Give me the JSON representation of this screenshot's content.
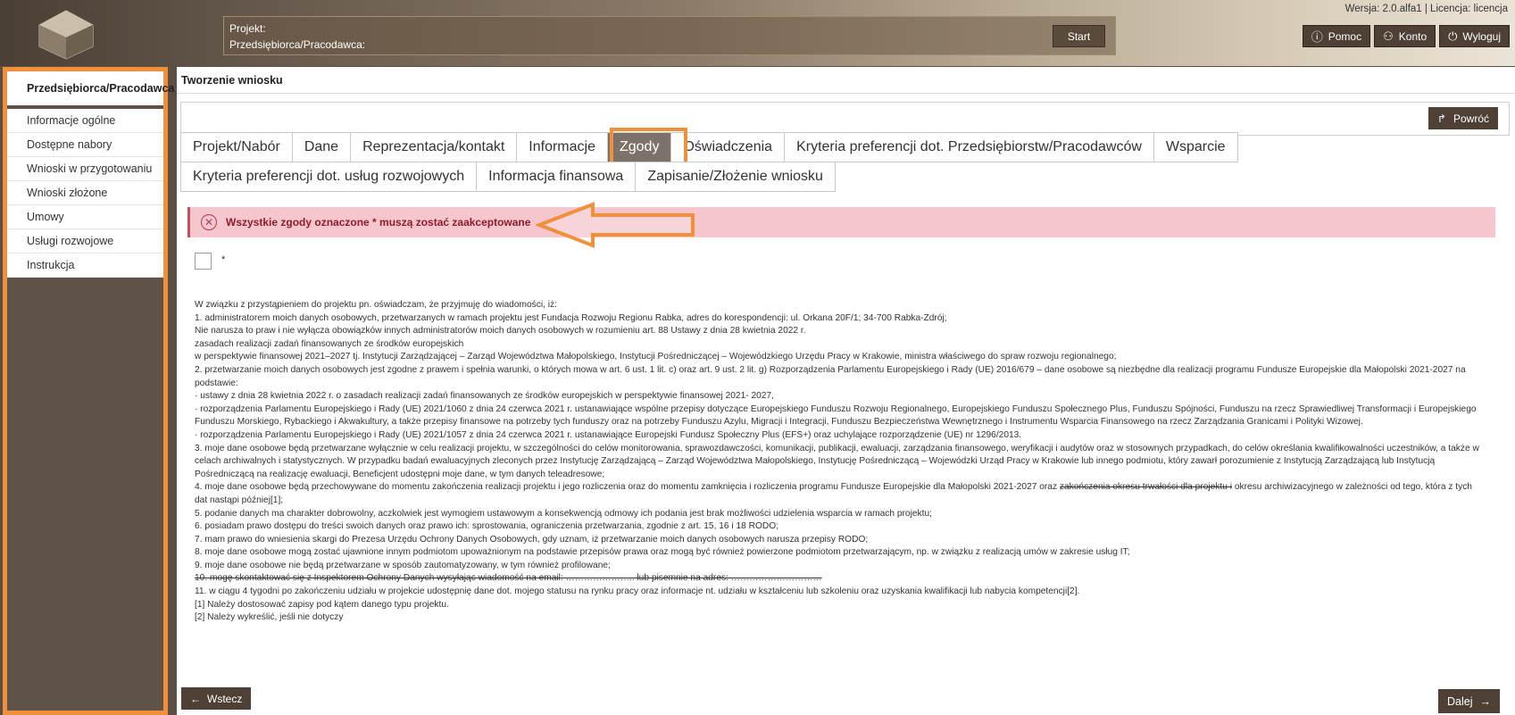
{
  "header": {
    "project_label": "Projekt:",
    "employer_label": "Przedsiębiorca/Pracodawca:",
    "start_label": "Start",
    "version_text": "Wersja: 2.0.alfa1 | Licencja: licencja",
    "help_label": "Pomoc",
    "account_label": "Konto",
    "logout_label": "Wyloguj"
  },
  "sidebar": {
    "header": "Przedsiębiorca/Pracodawca",
    "items": [
      {
        "label": "Informacje ogólne"
      },
      {
        "label": "Dostępne nabory"
      },
      {
        "label": "Wnioski w przygotowaniu"
      },
      {
        "label": "Wnioski złożone"
      },
      {
        "label": "Umowy"
      },
      {
        "label": "Usługi rozwojowe"
      },
      {
        "label": "Instrukcja"
      }
    ]
  },
  "main": {
    "title": "Tworzenie wniosku",
    "back_label": "Powróć",
    "tabs_row1": [
      {
        "label": "Projekt/Nabór"
      },
      {
        "label": "Dane"
      },
      {
        "label": "Reprezentacja/kontakt"
      },
      {
        "label": "Informacje"
      },
      {
        "label": "Zgody"
      },
      {
        "label": "Oświadczenia"
      },
      {
        "label": "Kryteria preferencji dot. Przedsiębiorstw/Pracodawców"
      },
      {
        "label": "Wsparcie"
      }
    ],
    "tabs_row2": [
      {
        "label": "Kryteria preferencji dot. usług rozwojowych"
      },
      {
        "label": "Informacja finansowa"
      },
      {
        "label": "Zapisanie/Złożenie wniosku"
      }
    ],
    "active_tab": "Zgody",
    "alert_text": "Wszystkie zgody oznaczone * muszą zostać zaakceptowane",
    "checkbox_marker": "*",
    "consent_lines": [
      "W związku z przystąpieniem do projektu pn.                                                                                                   oświadczam, że przyjmuję do wiadomości, iż:",
      "1.      administratorem moich danych osobowych, przetwarzanych w ramach projektu jest Fundacja Rozwoju Regionu Rabka, adres do korespondencji: ul. Orkana 20F/1; 34-700 Rabka-Zdrój;",
      "Nie narusza to praw i nie wyłącza obowiązków innych administratorów moich danych osobowych w rozumieniu art. 88 Ustawy z dnia 28 kwietnia 2022 r.",
      "zasadach realizacji zadań finansowanych ze środków europejskich",
      "w perspektywie finansowej 2021–2027 tj. Instytucji Zarządzającej – Zarząd Województwa Małopolskiego, Instytucji Pośredniczącej – Wojewódzkiego Urzędu Pracy w Krakowie, ministra właściwego do spraw rozwoju regionalnego;",
      "2.      przetwarzanie moich danych osobowych jest zgodne z prawem i spełnia warunki, o których mowa w art. 6 ust. 1 lit. c) oraz art. 9 ust. 2 lit. g) Rozporządzenia Parlamentu Europejskiego i Rady (UE) 2016/679 – dane osobowe są niezbędne dla realizacji programu Fundusze Europejskie dla Małopolski 2021-2027 na podstawie:",
      "·       ustawy z dnia 28 kwietnia 2022 r. o zasadach realizacji zadań finansowanych ze środków europejskich w perspektywie finansowej 2021- 2027,",
      "·       rozporządzenia Parlamentu Europejskiego i Rady (UE) 2021/1060 z dnia 24 czerwca 2021 r. ustanawiające wspólne przepisy dotyczące Europejskiego Funduszu Rozwoju Regionalnego, Europejskiego Funduszu Społecznego Plus, Funduszu Spójności, Funduszu na rzecz Sprawiedliwej Transformacji i Europejskiego Funduszu Morskiego, Rybackiego i Akwakultury, a także przepisy finansowe na potrzeby tych funduszy oraz na potrzeby Funduszu Azylu, Migracji i Integracji, Funduszu Bezpieczeństwa Wewnętrznego i Instrumentu Wsparcia Finansowego na rzecz Zarządzania Granicami i Polityki Wizowej.",
      "·       rozporządzenia Parlamentu Europejskiego i Rady (UE) 2021/1057 z dnia 24 czerwca 2021 r. ustanawiające Europejski Fundusz Społeczny Plus (EFS+) oraz uchylające rozporządzenie (UE) nr 1296/2013.",
      "3.      moje dane osobowe będą przetwarzane wyłącznie w celu realizacji projektu, w szczególności do celów monitorowania, sprawozdawczości, komunikacji, publikacji, ewaluacji, zarządzania finansowego, weryfikacji i audytów oraz w stosownych przypadkach, do celów określania kwalifikowalności uczestników, a także w celach archiwalnych i statystycznych. W przypadku badań ewaluacyjnych zleconych przez Instytucję Zarządzającą – Zarząd Województwa Małopolskiego, Instytucję Pośredniczącą – Wojewódzki Urząd Pracy w Krakowie lub innego podmiotu, który zawarł porozumienie z Instytucją Zarządzającą lub Instytucją Pośredniczącą na realizację ewaluacji, Beneficjent udostępni moje dane, w tym danych teleadresowe;",
      "5.      podanie danych ma charakter dobrowolny, aczkolwiek jest wymogiem ustawowym a konsekwencją odmowy ich podania jest brak możliwości udzielenia wsparcia w ramach projektu;",
      "6.      posiadam prawo dostępu do treści swoich danych oraz prawo ich: sprostowania, ograniczenia przetwarzania, zgodnie z art. 15, 16 i 18 RODO;",
      "7.      mam prawo do wniesienia skargi do Prezesa Urzędu Ochrony Danych Osobowych, gdy uznam, iż przetwarzanie moich danych osobowych narusza przepisy RODO;",
      "8.      moje dane osobowe mogą zostać ujawnione innym podmiotom upoważnionym na podstawie przepisów prawa oraz mogą być również powierzone podmiotom przetwarzającym, np. w związku z realizacją umów w zakresie usług IT;",
      "9.      moje dane osobowe nie będą przetwarzane w sposób zautomatyzowany, w tym również profilowane;"
    ],
    "line4_start": "4.      moje dane osobowe będą przechowywane do momentu zakończenia realizacji projektu i jego rozliczenia oraz do momentu zamknięcia i rozliczenia programu Fundusze Europejskie dla Małopolski 2021-2027 oraz ",
    "line4_strike": "zakończenia okresu trwałości dla projektu i",
    "line4_end": " okresu archiwizacyjnego w zależności od tego, która z tych dat nastąpi później[1];",
    "line10_strike": "10. mogę skontaktować się z Inspektorem Ochrony Danych wysyłając wiadomość na email: ………………….. lub pisemnie na adres: …………………………",
    "tail_lines": [
      "11. w ciągu 4 tygodni po zakończeniu udziału w projekcie udostępnię dane dot. mojego statusu na rynku pracy oraz informacje nt. udziału w kształceniu lub szkoleniu oraz uzyskania kwalifikacji lub nabycia kompetencji[2].",
      "[1] Należy dostosować zapisy pod kątem danego typu projektu.",
      "[2] Należy wykreślić, jeśli nie dotyczy"
    ],
    "prev_label": "Wstecz",
    "next_label": "Dalej"
  },
  "icons": {
    "back": "return-arrow-icon",
    "help": "info-circle-icon",
    "account": "user-icon",
    "logout": "power-icon",
    "alert": "error-x-circle-icon",
    "prev": "arrow-left-icon",
    "next": "arrow-right-icon"
  },
  "colors": {
    "accent": "#f0903a",
    "button_dark": "#4e4035",
    "active_tab": "#7d7269",
    "alert_bg": "#f5c6cd",
    "alert_text": "#8e1b2b"
  }
}
